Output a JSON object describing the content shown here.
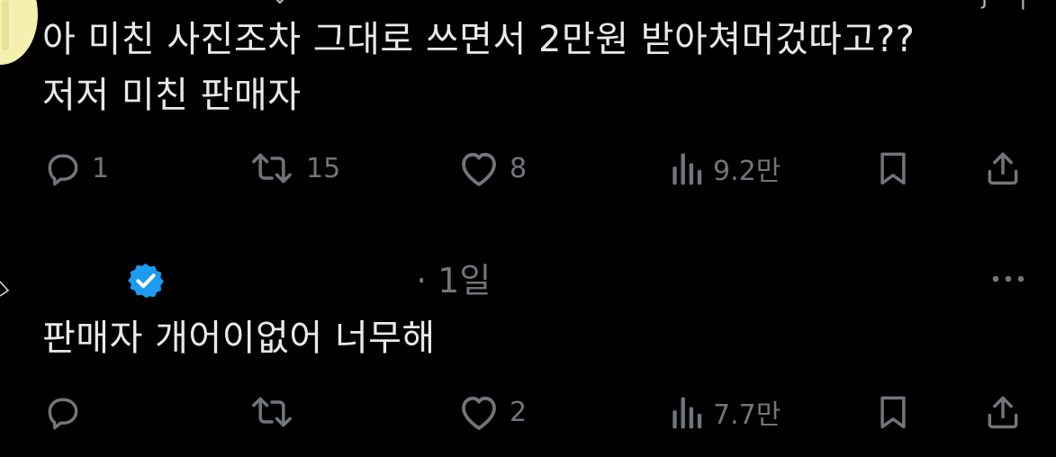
{
  "colors": {
    "background": "#000000",
    "text_primary": "#e7e9ea",
    "text_secondary": "#71767b",
    "verified_blue": "#1d9bf0",
    "avatar_yellow": "#f6f0b0"
  },
  "post": {
    "text_line_1": "아 미친 사진조차 그대로 쓰면서 2만원 받아쳐머겄따고??",
    "text_line_2": "저저 미친 판매자",
    "actions": {
      "reply_count": "1",
      "repost_count": "15",
      "like_count": "8",
      "views_count": "9.2만"
    }
  },
  "reply": {
    "timestamp": "· 1일",
    "text": "판매자 개어이없어 너무해",
    "actions": {
      "reply_count": "",
      "repost_count": "",
      "like_count": "2",
      "views_count": "7.7만"
    }
  },
  "icons": {
    "reply": "speech-bubble-icon",
    "repost": "repost-arrows-icon",
    "like": "heart-icon",
    "views": "bar-chart-icon",
    "bookmark": "bookmark-icon",
    "share": "share-upload-icon",
    "more": "more-dots-icon",
    "verified": "verified-badge-icon"
  }
}
